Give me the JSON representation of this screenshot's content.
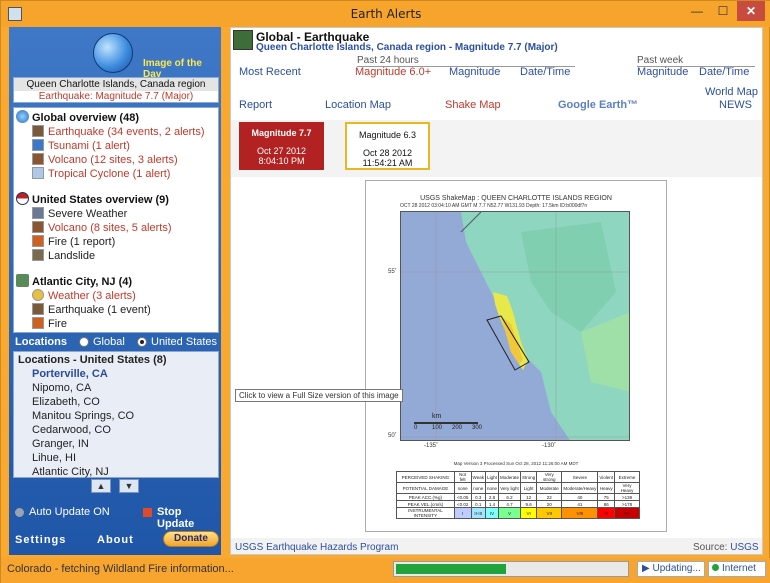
{
  "window": {
    "title": "Earth Alerts",
    "min": "—",
    "max": "☐",
    "close": "✕"
  },
  "left": {
    "image_of_day": "Image of the Day",
    "location_title": "Queen Charlotte Islands, Canada region",
    "location_subtitle": "Earthquake: Magnitude 7.7 (Major)",
    "global": {
      "header": "Global overview (48)",
      "items": [
        "Earthquake (34 events, 2 alerts)",
        "Tsunami (1 alert)",
        "Volcano (12 sites, 3 alerts)",
        "Tropical Cyclone (1 alert)"
      ]
    },
    "us": {
      "header": "United States overview (9)",
      "items": [
        "Severe Weather",
        "Volcano (8 sites, 5 alerts)",
        "Fire (1 report)",
        "Landslide"
      ]
    },
    "atlantic": {
      "header": "Atlantic City, NJ (4)",
      "items": [
        "Weather (3 alerts)",
        "Earthquake (1 event)",
        "Fire"
      ]
    },
    "locations_label": "Locations",
    "radio_global": "Global",
    "radio_us": "United States",
    "locations_header": "Locations - United States (8)",
    "locations": [
      "Porterville, CA",
      "Nipomo, CA",
      "Elizabeth, CO",
      "Manitou Springs, CO",
      "Cedarwood, CO",
      "Granger, IN",
      "Lihue, HI",
      "Atlantic City, NJ"
    ],
    "up_arrow": "▲",
    "down_arrow": "▼",
    "auto_update": "Auto Update ON",
    "stop_update": "Stop Update",
    "settings": "Settings",
    "about": "About",
    "donate": "Donate"
  },
  "right": {
    "title": "Global - Earthquake",
    "subtitle": "Queen Charlotte Islands, Canada region - Magnitude 7.7 (Major)",
    "past24_label": "Past 24 hours",
    "pastweek_label": "Past week",
    "links_row1": {
      "most_recent": "Most Recent",
      "magnitude_60": "Magnitude 6.0+",
      "magnitude": "Magnitude",
      "datetime": "Date/Time",
      "week_magnitude": "Magnitude",
      "week_datetime": "Date/Time"
    },
    "links_row2": {
      "report": "Report",
      "location_map": "Location Map",
      "shake_map": "Shake Map",
      "google_earth": "Google Earth™",
      "world_map": "World Map",
      "news": "NEWS"
    },
    "cards": [
      {
        "title": "Magnitude 7.7",
        "date": "Oct 27 2012",
        "time": "8:04:10 PM"
      },
      {
        "title": "Magnitude 6.3",
        "date": "Oct 28 2012",
        "time": "11:54:21 AM"
      }
    ],
    "map": {
      "title": "USGS ShakeMap : QUEEN CHARLOTTE ISLANDS REGION",
      "info": "OCT 28 2012 03:04:10 AM GMT   M 7.7   N52.77 W131.93   Depth: 17.5km   ID:b000df7n",
      "lat55": "55˚",
      "lat50": "50˚",
      "lon135": "-135˚",
      "lon130": "-130˚",
      "scale_unit": "km",
      "scale_ticks": [
        "0",
        "100",
        "200",
        "300"
      ],
      "tooltip": "Click to view a Full Size version of this image",
      "version": "Map Version 3 Processed Sun Oct 28, 2012 11:26:00 AM MDT",
      "legend_rows": [
        [
          "PERCEIVED SHAKING",
          "Not felt",
          "Weak",
          "Light",
          "Moderate",
          "Strong",
          "Very strong",
          "Severe",
          "Violent",
          "Extreme"
        ],
        [
          "POTENTIAL DAMAGE",
          "none",
          "none",
          "none",
          "Very light",
          "Light",
          "Moderate",
          "Moderate/Heavy",
          "Heavy",
          "Very Heavy"
        ],
        [
          "PEAK ACC.(%g)",
          "<0.05",
          "0.3",
          "2.8",
          "6.2",
          "12",
          "22",
          "40",
          "75",
          ">139"
        ],
        [
          "PEAK VEL.(cm/s)",
          "<0.02",
          "0.1",
          "1.4",
          "4.7",
          "9.6",
          "20",
          "41",
          "86",
          ">178"
        ],
        [
          "INSTRUMENTAL INTENSITY",
          "I",
          "II-III",
          "IV",
          "V",
          "VI",
          "VII",
          "VIII",
          "IX",
          "X+"
        ]
      ],
      "intensity_colors": [
        "#ffffff",
        "#bfccff",
        "#a0e6ff",
        "#80ffff",
        "#7aff93",
        "#ffff00",
        "#ffc800",
        "#ff9100",
        "#ff0000",
        "#c80000"
      ]
    },
    "footer_left": "USGS Earthquake Hazards Program",
    "footer_source_label": "Source:",
    "footer_source": "USGS"
  },
  "statusbar": {
    "text": "Colorado - fetching Wildland Fire information...",
    "progress": 0.46,
    "updating": "▶ Updating...",
    "internet": "Internet"
  }
}
